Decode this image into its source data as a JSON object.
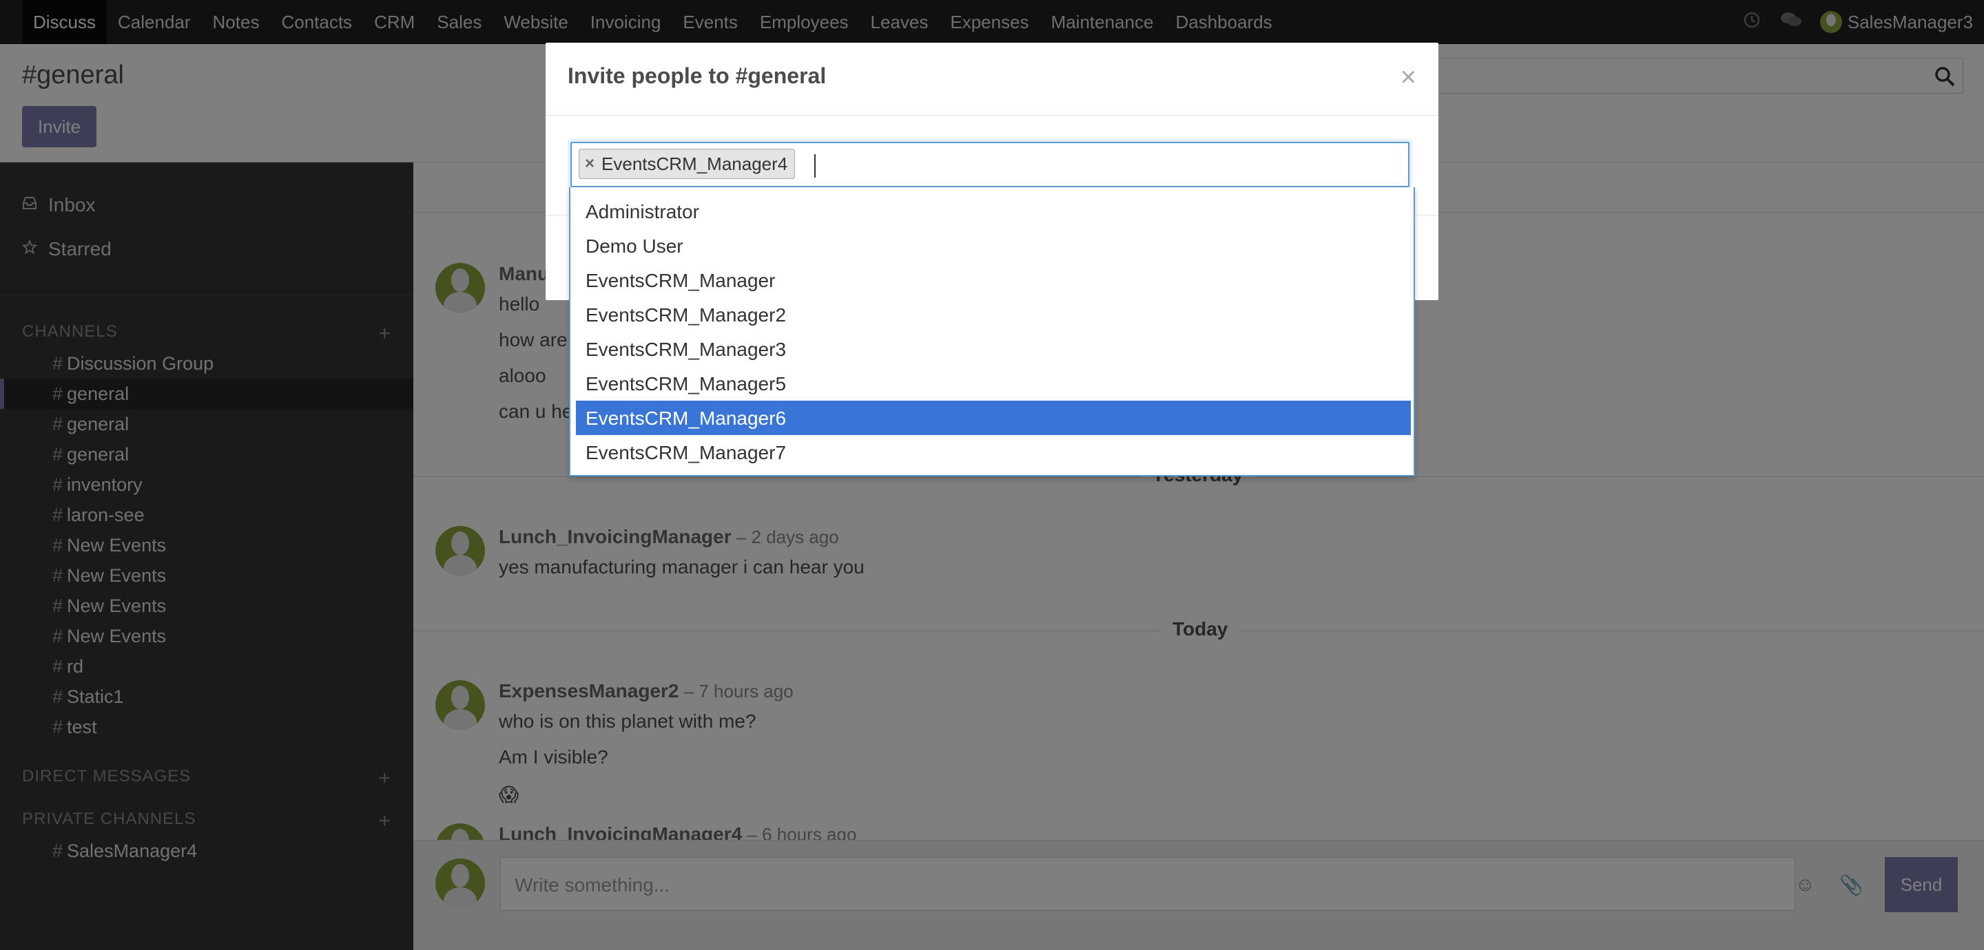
{
  "nav": {
    "items": [
      "Discuss",
      "Calendar",
      "Notes",
      "Contacts",
      "CRM",
      "Sales",
      "Website",
      "Invoicing",
      "Events",
      "Employees",
      "Leaves",
      "Expenses",
      "Maintenance",
      "Dashboards"
    ],
    "user": "SalesManager3",
    "icons": [
      "clock-icon",
      "chat-icon"
    ]
  },
  "control": {
    "title": "#general",
    "invite_label": "Invite"
  },
  "sidebar": {
    "inbox": "Inbox",
    "starred": "Starred",
    "channels_header": "CHANNELS",
    "channels": [
      "Discussion Group",
      "general",
      "general",
      "general",
      "inventory",
      "laron-see",
      "New Events",
      "New Events",
      "New Events",
      "New Events",
      "rd",
      "Static1",
      "test"
    ],
    "active_channel_index": 1,
    "direct_header": "DIRECT MESSAGES",
    "private_header": "PRIVATE CHANNELS",
    "private_channels": [
      "SalesManager4"
    ],
    "hash": "#"
  },
  "thread": {
    "first_msg": {
      "author": "Manu",
      "lines": [
        "hello",
        "how are",
        "alooo",
        "can u he"
      ]
    },
    "day_yesterday": "Yesterday",
    "msg_lunch": {
      "author": "Lunch_InvoicingManager",
      "date": " – 2 days ago",
      "text": "yes manufacturing manager i can hear you"
    },
    "day_today": "Today",
    "msg_expenses": {
      "author": "ExpensesManager2",
      "date": " – 7 hours ago",
      "lines": [
        "who is on this planet with me?",
        "Am I visible?",
        "😱"
      ]
    },
    "msg_lunch4": {
      "author": "Lunch_InvoicingManager4",
      "date": " – 6 hours ago"
    }
  },
  "composer": {
    "placeholder": "Write something...",
    "send_label": "Send",
    "emoji_icon": "☺",
    "attach_icon": "📎"
  },
  "modal": {
    "title": "Invite people to #general",
    "close": "×",
    "selected_tag": "EventsCRM_Manager4",
    "tag_remove": "×",
    "options": [
      "Administrator",
      "Demo User",
      "EventsCRM_Manager",
      "EventsCRM_Manager2",
      "EventsCRM_Manager3",
      "EventsCRM_Manager5",
      "EventsCRM_Manager6",
      "EventsCRM_Manager7"
    ],
    "highlighted_index": 6
  }
}
